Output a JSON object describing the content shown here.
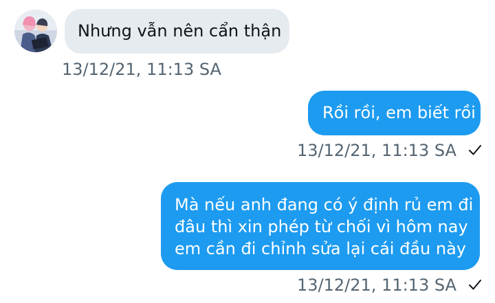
{
  "conversation": {
    "messages": [
      {
        "direction": "incoming",
        "text": "Nhưng vẫn nên cẩn thận",
        "timestamp": "13/12/21, 11:13 SA"
      },
      {
        "direction": "outgoing",
        "text": "Rồi rồi, em biết rồi",
        "timestamp": "13/12/21, 11:13 SA",
        "status_icon": "check-icon"
      },
      {
        "direction": "outgoing",
        "lines": [
          "Mà nếu anh đang có ý định rủ em đi",
          "đâu thì xin phép từ chối vì hôm nay",
          "em cần đi chỉnh sửa lại cái đầu này"
        ],
        "timestamp": "13/12/21, 11:13 SA",
        "status_icon": "check-icon"
      }
    ]
  },
  "colors": {
    "outgoing_bubble": "#1d9bf0",
    "incoming_bubble": "#e6ebf0",
    "timestamp_text": "#536471"
  }
}
